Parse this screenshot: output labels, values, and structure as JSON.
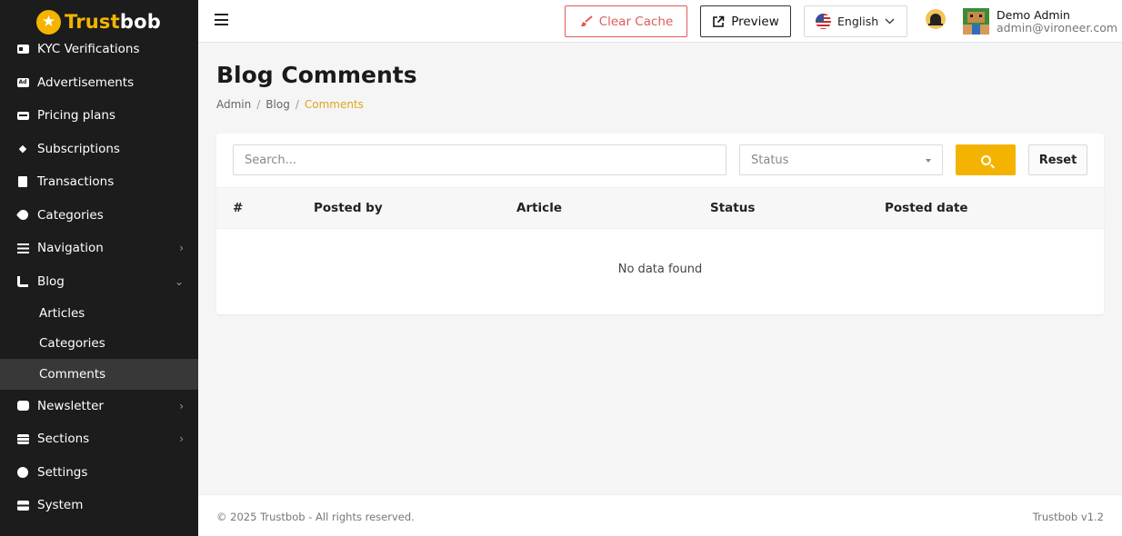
{
  "brand": {
    "prefix": "Trust",
    "suffix": "bob",
    "accent_color": "#f4b400"
  },
  "sidebar": {
    "items": [
      {
        "label": "KYC Verifications",
        "icon": "id-card-icon"
      },
      {
        "label": "Advertisements",
        "icon": "ad-icon"
      },
      {
        "label": "Pricing plans",
        "icon": "money-bill-icon"
      },
      {
        "label": "Subscriptions",
        "icon": "gem-icon"
      },
      {
        "label": "Transactions",
        "icon": "receipt-icon"
      },
      {
        "label": "Categories",
        "icon": "tag-icon"
      },
      {
        "label": "Navigation",
        "icon": "list-icon",
        "chevron": "›"
      },
      {
        "label": "Blog",
        "icon": "rss-icon",
        "chevron": "⌄"
      },
      {
        "label": "Newsletter",
        "icon": "newsletter-icon",
        "chevron": "›"
      },
      {
        "label": "Sections",
        "icon": "layers-icon",
        "chevron": "›"
      },
      {
        "label": "Settings",
        "icon": "gear-icon"
      },
      {
        "label": "System",
        "icon": "server-icon"
      }
    ],
    "blog_sub": [
      {
        "label": "Articles"
      },
      {
        "label": "Categories"
      },
      {
        "label": "Comments",
        "active": true
      }
    ]
  },
  "header": {
    "clear_cache_label": "Clear Cache",
    "preview_label": "Preview",
    "language": "English",
    "user_name": "Demo Admin",
    "user_email": "admin@vironeer.com"
  },
  "page": {
    "title": "Blog Comments",
    "breadcrumb": [
      "Admin",
      "Blog",
      "Comments"
    ]
  },
  "filters": {
    "search_placeholder": "Search...",
    "status_placeholder": "Status",
    "reset_label": "Reset"
  },
  "table": {
    "columns": [
      "#",
      "Posted by",
      "Article",
      "Status",
      "Posted date"
    ],
    "empty_text": "No data found"
  },
  "footer": {
    "copyright": "© 2025 Trustbob - All rights reserved.",
    "version": "Trustbob v1.2"
  }
}
